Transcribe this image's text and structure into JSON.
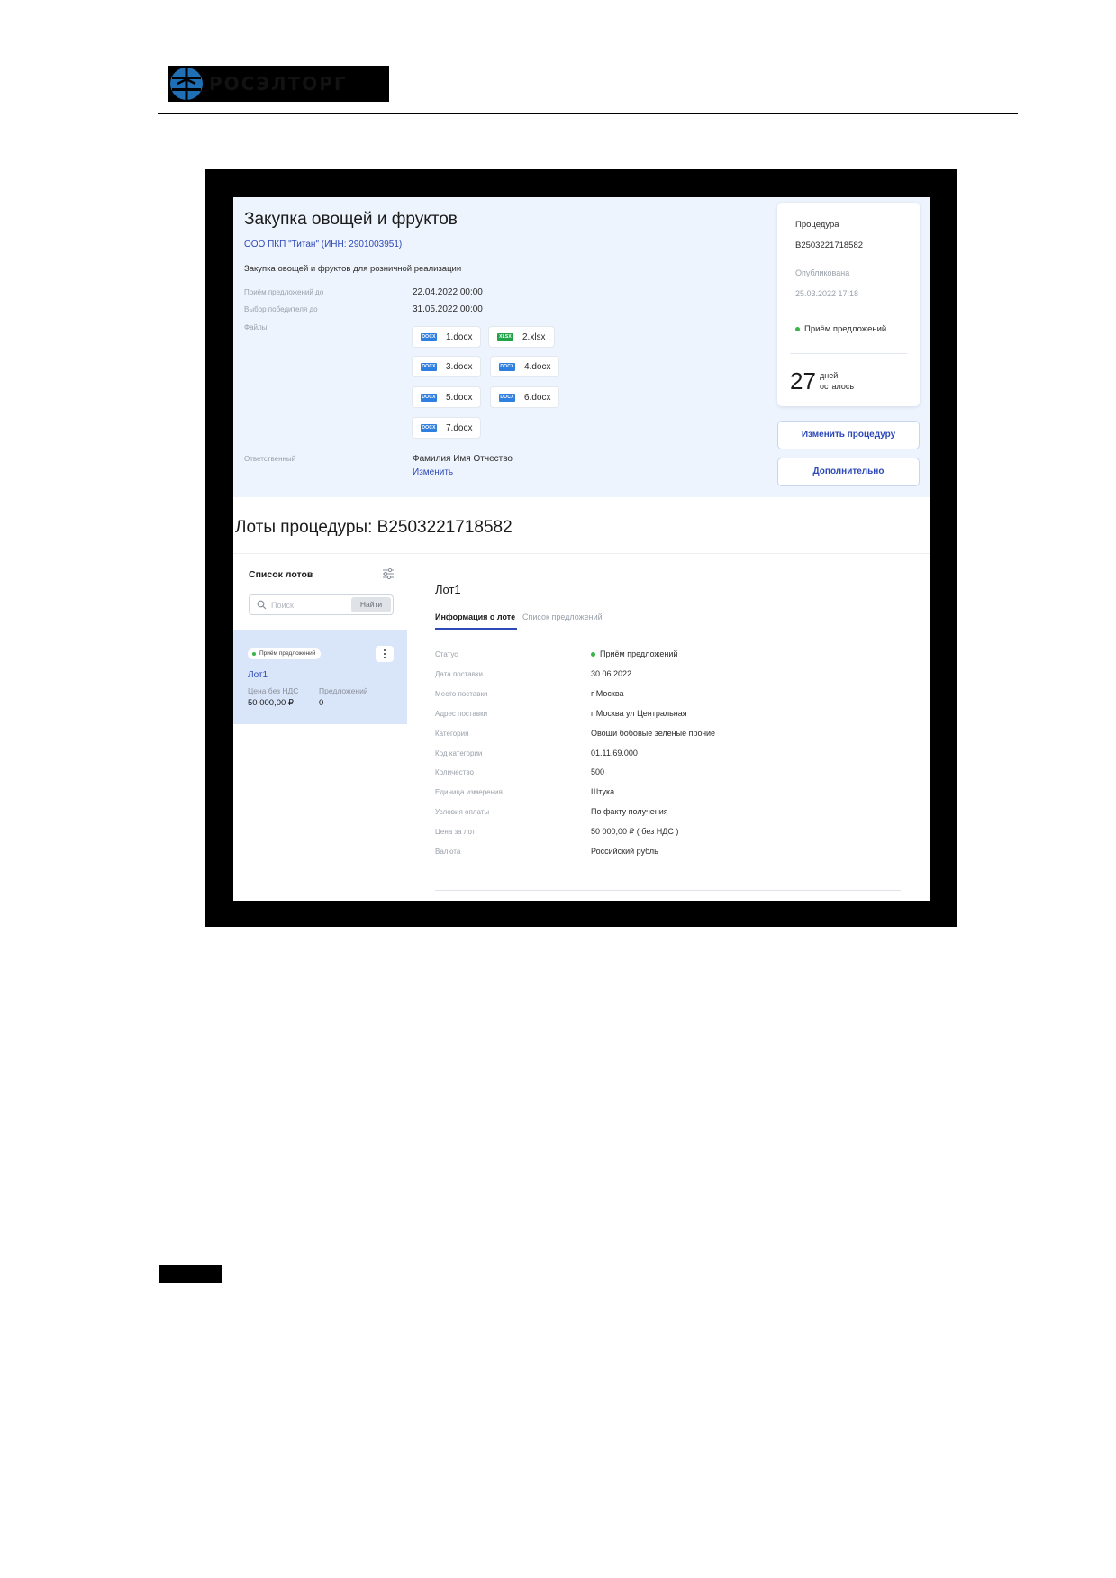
{
  "document": {
    "logo_text": "РОСЭЛТОРГ"
  },
  "procedure": {
    "title": "Закупка овощей и фруктов",
    "organization": "ООО ПКП \"Титан\" (ИНН: 2901003951)",
    "description": "Закупка овощей и фруктов для розничной реализации",
    "fields": {
      "offers_until_label": "Приём предложений до",
      "offers_until_value": "22.04.2022 00:00",
      "winner_until_label": "Выбор победителя до",
      "winner_until_value": "31.05.2022 00:00",
      "files_label": "Файлы",
      "responsible_label": "Ответственный",
      "responsible_value": "Фамилия Имя Отчество",
      "change_link": "Изменить"
    },
    "files": [
      {
        "name": "1.docx",
        "type": "DOCX"
      },
      {
        "name": "2.xlsx",
        "type": "XLSX"
      },
      {
        "name": "3.docx",
        "type": "DOCX"
      },
      {
        "name": "4.docx",
        "type": "DOCX"
      },
      {
        "name": "5.docx",
        "type": "DOCX"
      },
      {
        "name": "6.docx",
        "type": "DOCX"
      },
      {
        "name": "7.docx",
        "type": "DOCX"
      }
    ],
    "side": {
      "procedure_label": "Процедура",
      "procedure_number": "B2503221718582",
      "published_label": "Опубликована",
      "published_value": "25.03.2022 17:18",
      "status": "Приём предложений",
      "days_number": "27",
      "days_word": "дней",
      "days_left": "осталось"
    },
    "buttons": {
      "edit": "Изменить процедуру",
      "more": "Дополнительно"
    }
  },
  "lots": {
    "title": "Лоты процедуры: B2503221718582",
    "list_title": "Список лотов",
    "search_placeholder": "Поиск",
    "search_button": "Найти",
    "items": [
      {
        "status": "Приём предложений",
        "name": "Лот1",
        "price_label": "Цена без НДС",
        "price_value": "50 000,00 ₽",
        "offers_label": "Предложений",
        "offers_value": "0"
      }
    ],
    "detail": {
      "title": "Лот1",
      "tabs": [
        "Информация о лоте",
        "Список предложений"
      ],
      "rows": [
        {
          "label": "Статус",
          "value": "Приём предложений",
          "dot": true
        },
        {
          "label": "Дата поставки",
          "value": "30.06.2022"
        },
        {
          "label": "Место поставки",
          "value": "г Москва"
        },
        {
          "label": "Адрес поставки",
          "value": "г Москва ул Центральная"
        },
        {
          "label": "Категория",
          "value": "Овощи бобовые зеленые прочие"
        },
        {
          "label": "Код категории",
          "value": "01.11.69.000"
        },
        {
          "label": "Количество",
          "value": "500"
        },
        {
          "label": "Единица измерения",
          "value": "Штука"
        },
        {
          "label": "Условия оплаты",
          "value": "По факту получения"
        },
        {
          "label": "Цена за лот",
          "value": "50 000,00 ₽  ( без НДС )"
        },
        {
          "label": "Валюта",
          "value": "Российский рубль"
        }
      ]
    }
  },
  "colors": {
    "accent": "#2d49b8",
    "status_green": "#39b54a",
    "panel_bg": "#eef4fd",
    "selected_lot_bg": "#d9e6fa"
  }
}
